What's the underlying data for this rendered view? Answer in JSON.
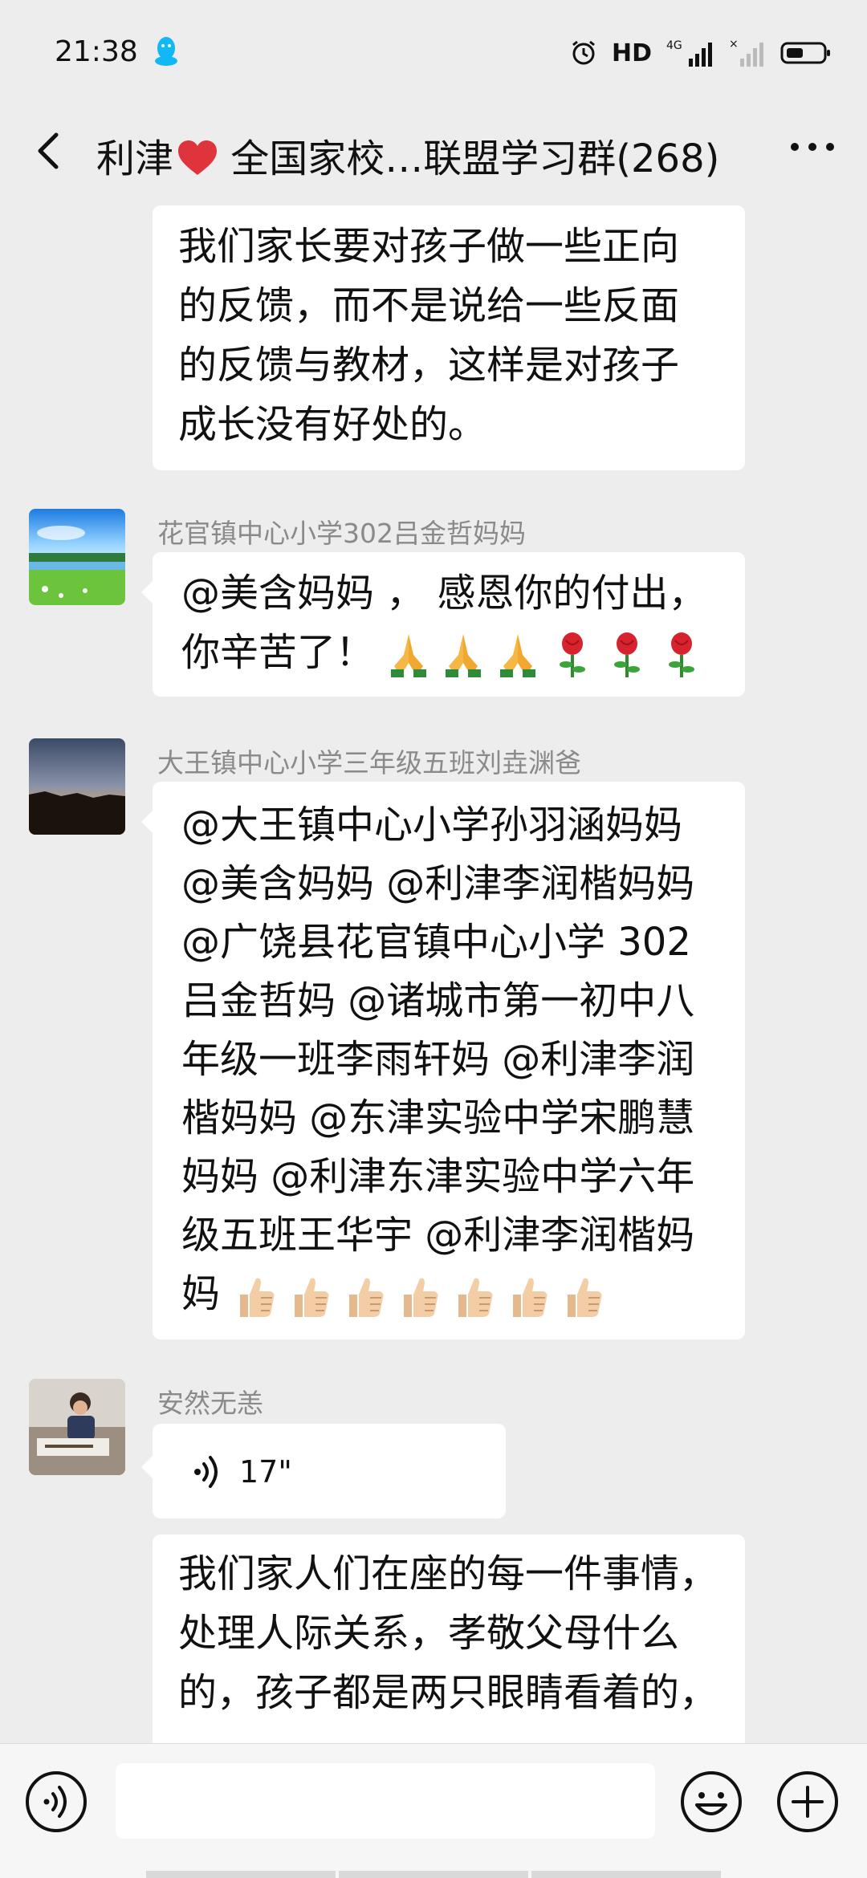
{
  "status_bar": {
    "time": "21:38",
    "hd_label": "HD",
    "network_label": "4G",
    "icons": [
      "qq-icon",
      "alarm-icon",
      "signal-icon",
      "battery-icon"
    ]
  },
  "header": {
    "title_prefix": "利津",
    "title_suffix": " 全国家校…联盟学习群(268)",
    "icons": [
      "back-icon",
      "heart-icon",
      "more-icon"
    ]
  },
  "messages": {
    "m1": {
      "lines": [
        "我们家长要对孩子做一些正向",
        "的反馈，而不是说给一些反面",
        "的反馈与教材，这样是对孩子",
        "成长没有好处的。"
      ]
    },
    "m2": {
      "sender": "花官镇中心小学302吕金哲妈妈",
      "lines": [
        "@美含妈妈 ， 感恩你的付出，",
        "你辛苦了！"
      ],
      "emojis": [
        "pray",
        "pray",
        "pray",
        "rose",
        "rose",
        "rose"
      ]
    },
    "m3": {
      "sender": "大王镇中心小学三年级五班刘垚渊爸",
      "lines": [
        "@大王镇中心小学孙羽涵妈妈",
        "@美含妈妈 @利津李润楷妈妈",
        " @广饶县花官镇中心小学 302",
        "吕金哲妈 @诸城市第一初中八",
        "年级一班李雨轩妈 @利津李润",
        "楷妈妈 @东津实验中学宋鹏慧",
        "妈妈 @利津东津实验中学六年",
        "级五班王华宇 @利津李润楷妈",
        "妈"
      ],
      "emojis": [
        "thumbs-up",
        "thumbs-up",
        "thumbs-up",
        "thumbs-up",
        "thumbs-up",
        "thumbs-up",
        "thumbs-up"
      ]
    },
    "m4": {
      "sender": "安然无恙",
      "voice_duration": "17\""
    },
    "m5": {
      "lines": [
        "我们家人们在座的每一件事情，",
        "处理人际关系，孝敬父母什么",
        "的，孩子都是两只眼睛看着的，"
      ]
    }
  },
  "input_bar": {
    "placeholder": "",
    "icons": [
      "voice-mode-icon",
      "emoji-icon",
      "plus-icon"
    ]
  },
  "colors": {
    "background": "#ededed",
    "bubble": "#ffffff",
    "sender_name": "#8a8a8a",
    "heart": "#e0343d"
  }
}
